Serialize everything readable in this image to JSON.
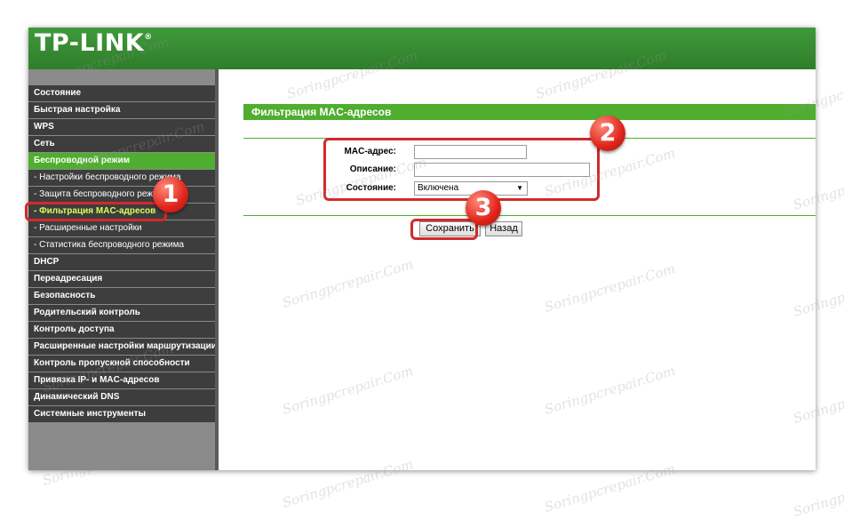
{
  "header": {
    "logo": "TP-LINK",
    "trademark": "®"
  },
  "sidebar": {
    "items": [
      {
        "label": "Состояние",
        "type": "top"
      },
      {
        "label": "Быстрая настройка",
        "type": "top"
      },
      {
        "label": "WPS",
        "type": "top"
      },
      {
        "label": "Сеть",
        "type": "top"
      },
      {
        "label": "Беспроводной режим",
        "type": "active"
      },
      {
        "label": "- Настройки беспроводного режима",
        "type": "sub"
      },
      {
        "label": "- Защита беспроводного режима",
        "type": "sub"
      },
      {
        "label": "- Фильтрация MAC-адресов",
        "type": "sub-active"
      },
      {
        "label": "- Расширенные настройки",
        "type": "sub"
      },
      {
        "label": "- Статистика беспроводного режима",
        "type": "sub"
      },
      {
        "label": "DHCP",
        "type": "top"
      },
      {
        "label": "Переадресация",
        "type": "top"
      },
      {
        "label": "Безопасность",
        "type": "top"
      },
      {
        "label": "Родительский контроль",
        "type": "top"
      },
      {
        "label": "Контроль доступа",
        "type": "top"
      },
      {
        "label": "Расширенные настройки маршрутизации",
        "type": "top"
      },
      {
        "label": "Контроль пропускной способности",
        "type": "top"
      },
      {
        "label": "Привязка IP- и MAC-адресов",
        "type": "top"
      },
      {
        "label": "Динамический DNS",
        "type": "top"
      },
      {
        "label": "Системные инструменты",
        "type": "top"
      }
    ]
  },
  "main": {
    "title": "Фильтрация MAC-адресов",
    "form": {
      "mac_label": "MAC-адрес:",
      "mac_value": "",
      "desc_label": "Описание:",
      "desc_value": "",
      "status_label": "Состояние:",
      "status_value": "Включена"
    },
    "buttons": {
      "save": "Сохранить",
      "back": "Назад"
    }
  },
  "callouts": {
    "one": "1",
    "two": "2",
    "three": "3"
  },
  "watermark": "Soringpcrepair.Com",
  "colors": {
    "header_green": "#3a8f35",
    "accent_green": "#4fae2f",
    "callout_red": "#d22a2a"
  }
}
